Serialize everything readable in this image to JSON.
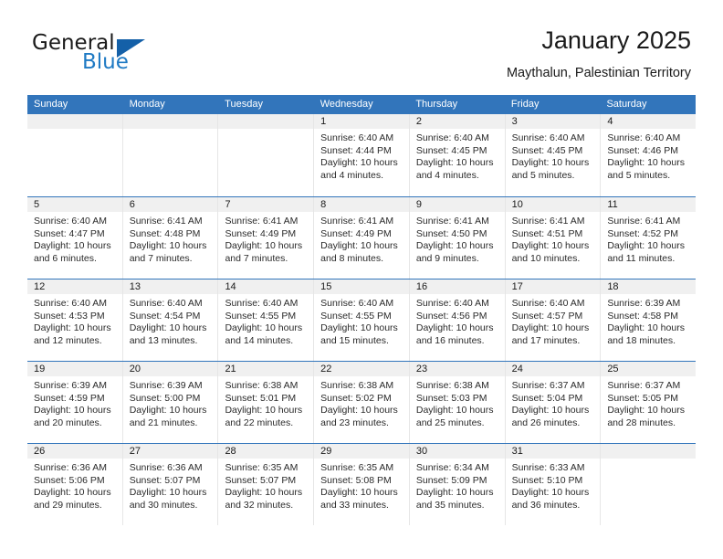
{
  "brand": {
    "name_part1": "General",
    "name_part2": "Blue",
    "accent_color": "#1f7ac4",
    "triangle_color": "#1460a8"
  },
  "header": {
    "title": "January 2025",
    "subtitle": "Maythalun, Palestinian Territory"
  },
  "calendar": {
    "header_bg": "#3275bb",
    "daynum_bg": "#f0f0f0",
    "weekdays": [
      "Sunday",
      "Monday",
      "Tuesday",
      "Wednesday",
      "Thursday",
      "Friday",
      "Saturday"
    ],
    "weeks": [
      [
        {
          "day": "",
          "sunrise": "",
          "sunset": "",
          "daylight": "",
          "empty": true
        },
        {
          "day": "",
          "sunrise": "",
          "sunset": "",
          "daylight": "",
          "empty": true
        },
        {
          "day": "",
          "sunrise": "",
          "sunset": "",
          "daylight": "",
          "empty": true
        },
        {
          "day": "1",
          "sunrise": "Sunrise: 6:40 AM",
          "sunset": "Sunset: 4:44 PM",
          "daylight": "Daylight: 10 hours and 4 minutes."
        },
        {
          "day": "2",
          "sunrise": "Sunrise: 6:40 AM",
          "sunset": "Sunset: 4:45 PM",
          "daylight": "Daylight: 10 hours and 4 minutes."
        },
        {
          "day": "3",
          "sunrise": "Sunrise: 6:40 AM",
          "sunset": "Sunset: 4:45 PM",
          "daylight": "Daylight: 10 hours and 5 minutes."
        },
        {
          "day": "4",
          "sunrise": "Sunrise: 6:40 AM",
          "sunset": "Sunset: 4:46 PM",
          "daylight": "Daylight: 10 hours and 5 minutes."
        }
      ],
      [
        {
          "day": "5",
          "sunrise": "Sunrise: 6:40 AM",
          "sunset": "Sunset: 4:47 PM",
          "daylight": "Daylight: 10 hours and 6 minutes."
        },
        {
          "day": "6",
          "sunrise": "Sunrise: 6:41 AM",
          "sunset": "Sunset: 4:48 PM",
          "daylight": "Daylight: 10 hours and 7 minutes."
        },
        {
          "day": "7",
          "sunrise": "Sunrise: 6:41 AM",
          "sunset": "Sunset: 4:49 PM",
          "daylight": "Daylight: 10 hours and 7 minutes."
        },
        {
          "day": "8",
          "sunrise": "Sunrise: 6:41 AM",
          "sunset": "Sunset: 4:49 PM",
          "daylight": "Daylight: 10 hours and 8 minutes."
        },
        {
          "day": "9",
          "sunrise": "Sunrise: 6:41 AM",
          "sunset": "Sunset: 4:50 PM",
          "daylight": "Daylight: 10 hours and 9 minutes."
        },
        {
          "day": "10",
          "sunrise": "Sunrise: 6:41 AM",
          "sunset": "Sunset: 4:51 PM",
          "daylight": "Daylight: 10 hours and 10 minutes."
        },
        {
          "day": "11",
          "sunrise": "Sunrise: 6:41 AM",
          "sunset": "Sunset: 4:52 PM",
          "daylight": "Daylight: 10 hours and 11 minutes."
        }
      ],
      [
        {
          "day": "12",
          "sunrise": "Sunrise: 6:40 AM",
          "sunset": "Sunset: 4:53 PM",
          "daylight": "Daylight: 10 hours and 12 minutes."
        },
        {
          "day": "13",
          "sunrise": "Sunrise: 6:40 AM",
          "sunset": "Sunset: 4:54 PM",
          "daylight": "Daylight: 10 hours and 13 minutes."
        },
        {
          "day": "14",
          "sunrise": "Sunrise: 6:40 AM",
          "sunset": "Sunset: 4:55 PM",
          "daylight": "Daylight: 10 hours and 14 minutes."
        },
        {
          "day": "15",
          "sunrise": "Sunrise: 6:40 AM",
          "sunset": "Sunset: 4:55 PM",
          "daylight": "Daylight: 10 hours and 15 minutes."
        },
        {
          "day": "16",
          "sunrise": "Sunrise: 6:40 AM",
          "sunset": "Sunset: 4:56 PM",
          "daylight": "Daylight: 10 hours and 16 minutes."
        },
        {
          "day": "17",
          "sunrise": "Sunrise: 6:40 AM",
          "sunset": "Sunset: 4:57 PM",
          "daylight": "Daylight: 10 hours and 17 minutes."
        },
        {
          "day": "18",
          "sunrise": "Sunrise: 6:39 AM",
          "sunset": "Sunset: 4:58 PM",
          "daylight": "Daylight: 10 hours and 18 minutes."
        }
      ],
      [
        {
          "day": "19",
          "sunrise": "Sunrise: 6:39 AM",
          "sunset": "Sunset: 4:59 PM",
          "daylight": "Daylight: 10 hours and 20 minutes."
        },
        {
          "day": "20",
          "sunrise": "Sunrise: 6:39 AM",
          "sunset": "Sunset: 5:00 PM",
          "daylight": "Daylight: 10 hours and 21 minutes."
        },
        {
          "day": "21",
          "sunrise": "Sunrise: 6:38 AM",
          "sunset": "Sunset: 5:01 PM",
          "daylight": "Daylight: 10 hours and 22 minutes."
        },
        {
          "day": "22",
          "sunrise": "Sunrise: 6:38 AM",
          "sunset": "Sunset: 5:02 PM",
          "daylight": "Daylight: 10 hours and 23 minutes."
        },
        {
          "day": "23",
          "sunrise": "Sunrise: 6:38 AM",
          "sunset": "Sunset: 5:03 PM",
          "daylight": "Daylight: 10 hours and 25 minutes."
        },
        {
          "day": "24",
          "sunrise": "Sunrise: 6:37 AM",
          "sunset": "Sunset: 5:04 PM",
          "daylight": "Daylight: 10 hours and 26 minutes."
        },
        {
          "day": "25",
          "sunrise": "Sunrise: 6:37 AM",
          "sunset": "Sunset: 5:05 PM",
          "daylight": "Daylight: 10 hours and 28 minutes."
        }
      ],
      [
        {
          "day": "26",
          "sunrise": "Sunrise: 6:36 AM",
          "sunset": "Sunset: 5:06 PM",
          "daylight": "Daylight: 10 hours and 29 minutes."
        },
        {
          "day": "27",
          "sunrise": "Sunrise: 6:36 AM",
          "sunset": "Sunset: 5:07 PM",
          "daylight": "Daylight: 10 hours and 30 minutes."
        },
        {
          "day": "28",
          "sunrise": "Sunrise: 6:35 AM",
          "sunset": "Sunset: 5:07 PM",
          "daylight": "Daylight: 10 hours and 32 minutes."
        },
        {
          "day": "29",
          "sunrise": "Sunrise: 6:35 AM",
          "sunset": "Sunset: 5:08 PM",
          "daylight": "Daylight: 10 hours and 33 minutes."
        },
        {
          "day": "30",
          "sunrise": "Sunrise: 6:34 AM",
          "sunset": "Sunset: 5:09 PM",
          "daylight": "Daylight: 10 hours and 35 minutes."
        },
        {
          "day": "31",
          "sunrise": "Sunrise: 6:33 AM",
          "sunset": "Sunset: 5:10 PM",
          "daylight": "Daylight: 10 hours and 36 minutes."
        },
        {
          "day": "",
          "sunrise": "",
          "sunset": "",
          "daylight": "",
          "empty": true
        }
      ]
    ]
  }
}
